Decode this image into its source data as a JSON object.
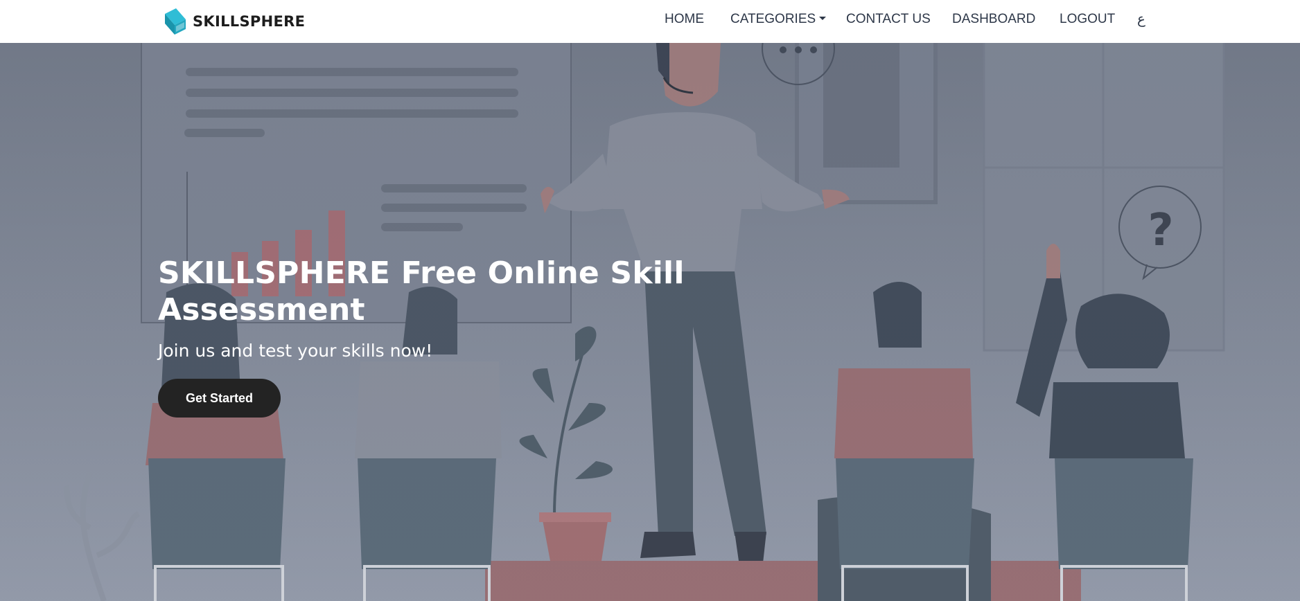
{
  "brand": {
    "name": "SKILLSPHERE"
  },
  "nav": {
    "home": "HOME",
    "categories": "CATEGORIES",
    "contact": "CONTACT US",
    "dashboard": "DASHBOARD",
    "logout": "LOGOUT",
    "language": "ع"
  },
  "hero": {
    "title": "SKILLSPHERE Free Online Skill Assessment",
    "subtitle": "Join us and test your skills now!",
    "cta": "Get Started",
    "bubble_left": "•••",
    "bubble_right": "?"
  },
  "colors": {
    "brand_icon": "#2ab0c8",
    "cta_bg": "#232323",
    "hero_bg": "#7e8795",
    "bar_red": "#b06d72"
  }
}
